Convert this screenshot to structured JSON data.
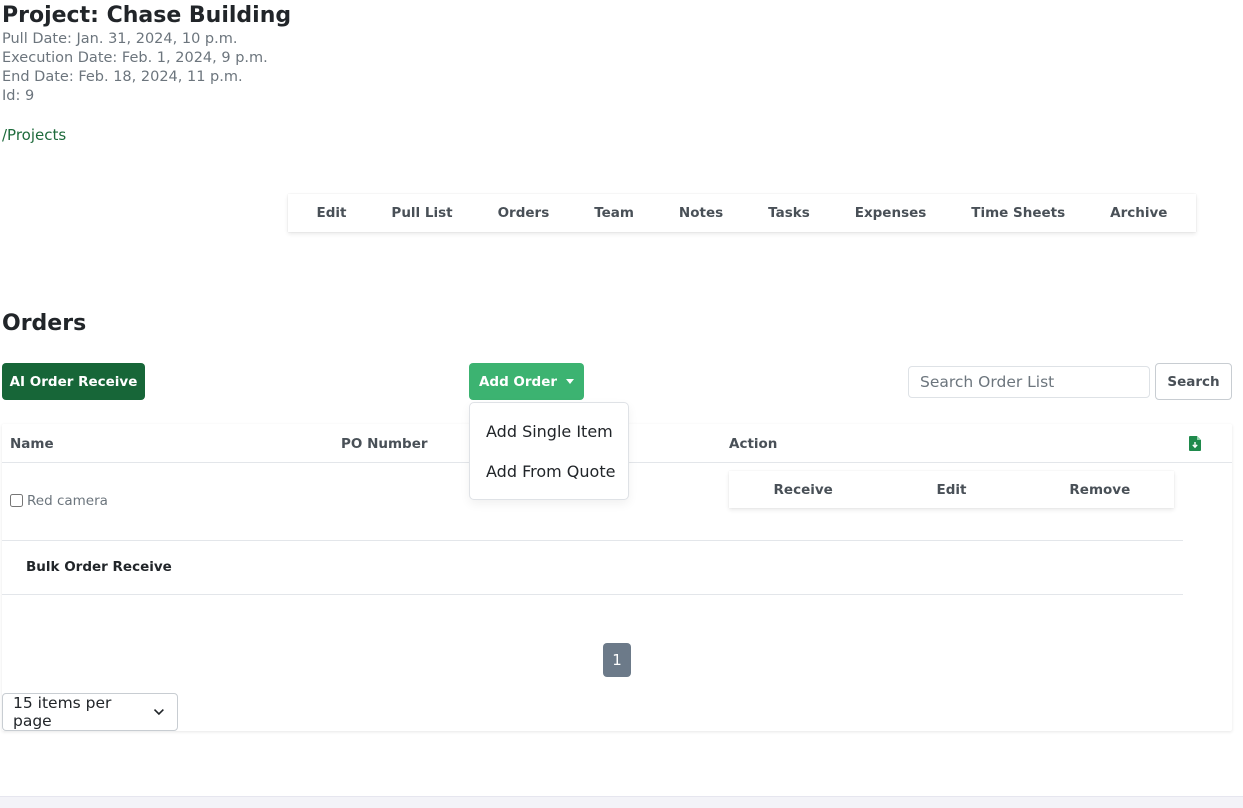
{
  "project": {
    "title": "Project: Chase Building",
    "pull_date": "Pull Date: Jan. 31, 2024, 10 p.m.",
    "execution_date": "Execution Date: Feb. 1, 2024, 9 p.m.",
    "end_date": "End Date: Feb. 18, 2024, 11 p.m.",
    "id": "Id: 9",
    "breadcrumb": "/Projects"
  },
  "subnav": {
    "items": [
      "Edit",
      "Pull List",
      "Orders",
      "Team",
      "Notes",
      "Tasks",
      "Expenses",
      "Time Sheets",
      "Archive"
    ]
  },
  "orders": {
    "title": "Orders",
    "ai_receive_label": "AI Order Receive",
    "add_order_label": "Add Order",
    "search_placeholder": "Search Order List",
    "search_label": "Search",
    "dropdown": {
      "items": [
        "Add Single Item",
        "Add From Quote"
      ]
    },
    "columns": [
      "Name",
      "PO Number",
      "Action"
    ],
    "rows": [
      {
        "name": "Red camera",
        "checked": false,
        "actions": [
          "Receive",
          "Edit",
          "Remove"
        ]
      }
    ],
    "bulk_receive_label": "Bulk Order Receive",
    "pagination": {
      "current_page": "1"
    },
    "per_page": {
      "selected": "15 items per page"
    },
    "export_icon": "file-export-icon"
  },
  "colors": {
    "primary_dark": "#176638",
    "primary": "#3cb371",
    "link": "#1e6b3c",
    "page_active": "#6c7a89"
  }
}
